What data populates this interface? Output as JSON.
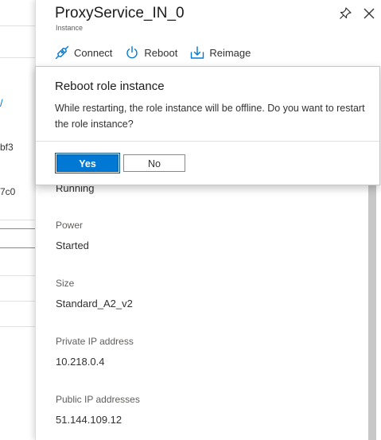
{
  "background": {
    "link_fragment": "/",
    "text_1": "bf3",
    "text_2": "7c0"
  },
  "panel": {
    "title": "ProxyService_IN_0",
    "subtitle": "Instance",
    "toolbar": {
      "connect": "Connect",
      "reboot": "Reboot",
      "reimage": "Reimage"
    },
    "properties": [
      {
        "label": "",
        "value": "Running"
      },
      {
        "label": "Power",
        "value": "Started"
      },
      {
        "label": "Size",
        "value": "Standard_A2_v2"
      },
      {
        "label": "Private IP address",
        "value": "10.218.0.4"
      },
      {
        "label": "Public IP addresses",
        "value": "51.144.109.12"
      }
    ]
  },
  "dialog": {
    "title": "Reboot role instance",
    "message": "While restarting, the role instance will be offline. Do you want to restart the role instance?",
    "yes_label": "Yes",
    "no_label": "No"
  },
  "icons": {
    "pin": "pin-icon",
    "close": "close-icon",
    "connect": "connect-plug-icon",
    "reboot": "power-icon",
    "reimage": "download-arrow-icon"
  },
  "colors": {
    "accent": "#0078d4",
    "scrollbar": "#c8c8c8"
  }
}
